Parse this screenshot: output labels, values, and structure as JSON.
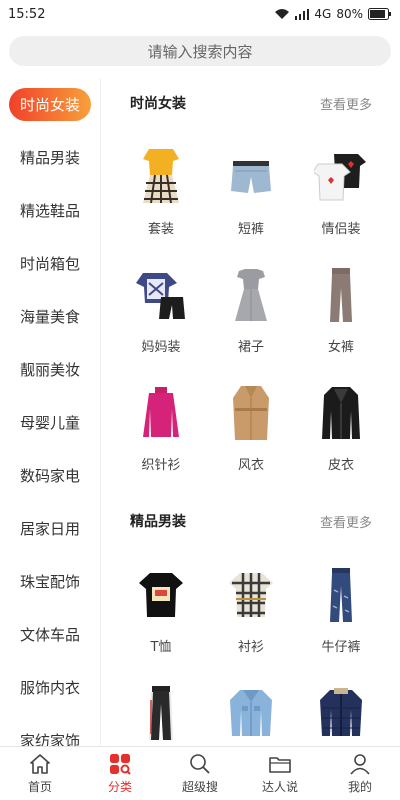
{
  "status": {
    "time": "15:52",
    "network": "4G",
    "battery": "80%"
  },
  "search": {
    "placeholder": "请输入搜索内容"
  },
  "sidebar": {
    "items": [
      {
        "label": "时尚女装",
        "active": true
      },
      {
        "label": "精品男装"
      },
      {
        "label": "精选鞋品"
      },
      {
        "label": "时尚箱包"
      },
      {
        "label": "海量美食"
      },
      {
        "label": "靓丽美妆"
      },
      {
        "label": "母婴儿童"
      },
      {
        "label": "数码家电"
      },
      {
        "label": "居家日用"
      },
      {
        "label": "珠宝配饰"
      },
      {
        "label": "文体车品"
      },
      {
        "label": "服饰内衣"
      },
      {
        "label": "家纺家饰"
      }
    ]
  },
  "sections": [
    {
      "title": "时尚女装",
      "more": "查看更多",
      "items": [
        {
          "label": "套装",
          "icon": "skirt-set-thumb"
        },
        {
          "label": "短裤",
          "icon": "denim-shorts-thumb"
        },
        {
          "label": "情侣装",
          "icon": "couple-tees-thumb"
        },
        {
          "label": "妈妈装",
          "icon": "mom-outfit-thumb"
        },
        {
          "label": "裙子",
          "icon": "dress-thumb"
        },
        {
          "label": "女裤",
          "icon": "women-pants-thumb"
        },
        {
          "label": "织针衫",
          "icon": "knit-sweater-thumb"
        },
        {
          "label": "风衣",
          "icon": "trench-coat-thumb"
        },
        {
          "label": "皮衣",
          "icon": "leather-jacket-thumb"
        }
      ]
    },
    {
      "title": "精品男装",
      "more": "查看更多",
      "items": [
        {
          "label": "T恤",
          "icon": "tshirt-thumb"
        },
        {
          "label": "衬衫",
          "icon": "plaid-shirt-thumb"
        },
        {
          "label": "牛仔裤",
          "icon": "jeans-thumb"
        },
        {
          "label": "",
          "icon": "track-pants-thumb"
        },
        {
          "label": "",
          "icon": "denim-jacket-thumb"
        },
        {
          "label": "",
          "icon": "puffer-jacket-thumb"
        }
      ]
    }
  ],
  "tabs": [
    {
      "label": "首页",
      "icon": "home-icon"
    },
    {
      "label": "分类",
      "icon": "category-icon",
      "active": true
    },
    {
      "label": "超级搜",
      "icon": "search-icon"
    },
    {
      "label": "达人说",
      "icon": "folder-icon"
    },
    {
      "label": "我的",
      "icon": "profile-icon"
    }
  ],
  "colors": {
    "accent": "#e5302b",
    "gradient_start": "#f0402a",
    "gradient_end": "#f7a13b"
  }
}
